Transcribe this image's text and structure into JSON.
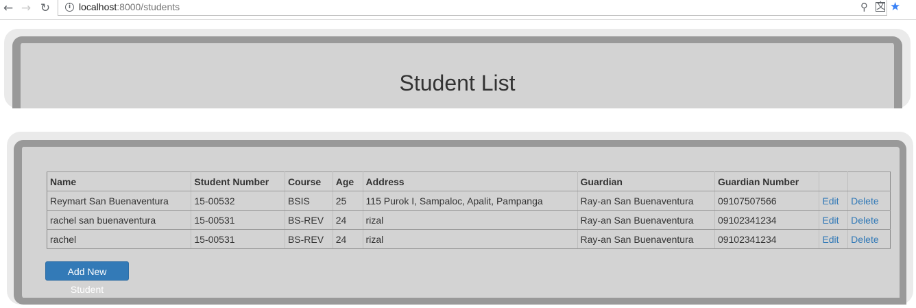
{
  "browser": {
    "url_host": "localhost",
    "url_rest": ":8000/students",
    "icons": [
      "back-icon",
      "forward-icon",
      "reload-icon",
      "info-icon",
      "zoom-icon",
      "translate-icon",
      "star-icon"
    ]
  },
  "header": {
    "title": "Student List"
  },
  "table": {
    "columns": [
      "Name",
      "Student Number",
      "Course",
      "Age",
      "Address",
      "Guardian",
      "Guardian Number",
      "",
      ""
    ],
    "rows": [
      [
        "Reymart San Buenaventura",
        "15-00532",
        "BSIS",
        "25",
        "115 Purok I, Sampaloc, Apalit, Pampanga",
        "Ray-an San Buenaventura",
        "09107507566",
        "Edit",
        "Delete"
      ],
      [
        "rachel san buenaventura",
        "15-00531",
        "BS-REV",
        "24",
        "rizal",
        "Ray-an San Buenaventura",
        "09102341234",
        "Edit",
        "Delete"
      ],
      [
        "rachel",
        "15-00531",
        "BS-REV",
        "24",
        "rizal",
        "Ray-an San Buenaventura",
        "09102341234",
        "Edit",
        "Delete"
      ]
    ]
  },
  "actions": {
    "add_label": "Add New Student"
  },
  "colors": {
    "accent": "#337ab7",
    "panel_bg": "#d3d3d3",
    "panel_border": "#999999",
    "outer_bg": "#eaeaea"
  }
}
